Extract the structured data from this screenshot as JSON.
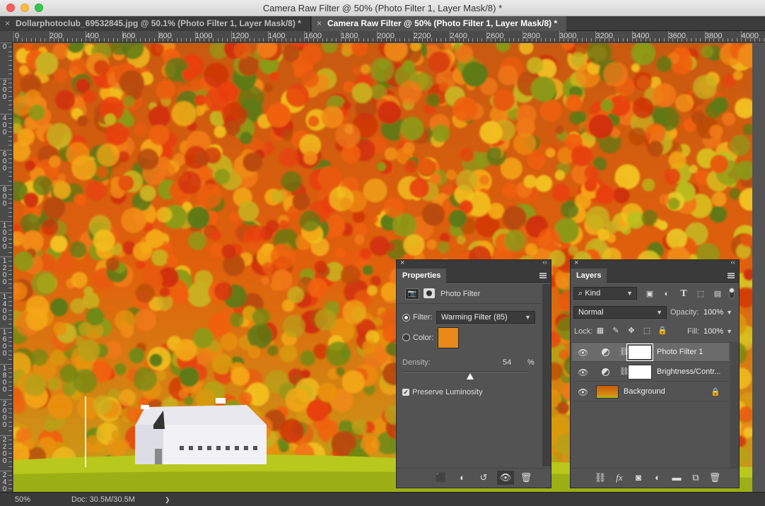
{
  "window": {
    "title": "Camera Raw Filter @ 50% (Photo Filter 1, Layer Mask/8) *"
  },
  "tabs": [
    {
      "label": "Dollarphotoclub_69532845.jpg @ 50.1% (Photo Filter 1, Layer Mask/8) *",
      "close": "×"
    },
    {
      "label": "Camera Raw Filter @ 50% (Photo Filter 1, Layer Mask/8) *",
      "close": "×"
    }
  ],
  "ruler": {
    "top": [
      "200",
      "400",
      "600",
      "800",
      "1000",
      "1200",
      "1400",
      "1600",
      "1800",
      "2000",
      "2200",
      "2400",
      "2600",
      "2800",
      "3000",
      "3200",
      "3400",
      "3600",
      "3800",
      "4000"
    ],
    "top_zero": "0",
    "left": [
      "0",
      "200",
      "400",
      "600",
      "800",
      "1000",
      "1200",
      "1400",
      "1600",
      "1800",
      "2000",
      "2200",
      "2400"
    ]
  },
  "status": {
    "zoom": "50%",
    "doc": "Doc: 30.5M/30.5M",
    "arrow": "❯"
  },
  "properties": {
    "tab": "Properties",
    "close": "×",
    "collapse": "‹‹",
    "adjustment_name": "Photo Filter",
    "filter_label": "Filter:",
    "filter_value": "Warming Filter (85)",
    "color_label": "Color:",
    "color_swatch": "#e8891a",
    "density_label": "Density:",
    "density_value": "54",
    "density_unit": "%",
    "density_fraction": 0.54,
    "preserve_label": "Preserve Luminosity",
    "preserve_checked": true
  },
  "layers": {
    "tab": "Layers",
    "close": "×",
    "collapse": "‹‹",
    "kind_label": "Kind",
    "search_glyph": "⌕",
    "blend_mode": "Normal",
    "opacity_label": "Opacity:",
    "opacity_value": "100%",
    "lock_label": "Lock:",
    "fill_label": "Fill:",
    "fill_value": "100%",
    "items": [
      {
        "name": "Photo Filter 1"
      },
      {
        "name": "Brightness/Contr..."
      },
      {
        "name": "Background"
      }
    ],
    "footer": {
      "fx": "fx"
    }
  },
  "colors": {
    "accent": "#e8891a",
    "panel": "#535353",
    "panel_dark": "#3a3a3a"
  }
}
